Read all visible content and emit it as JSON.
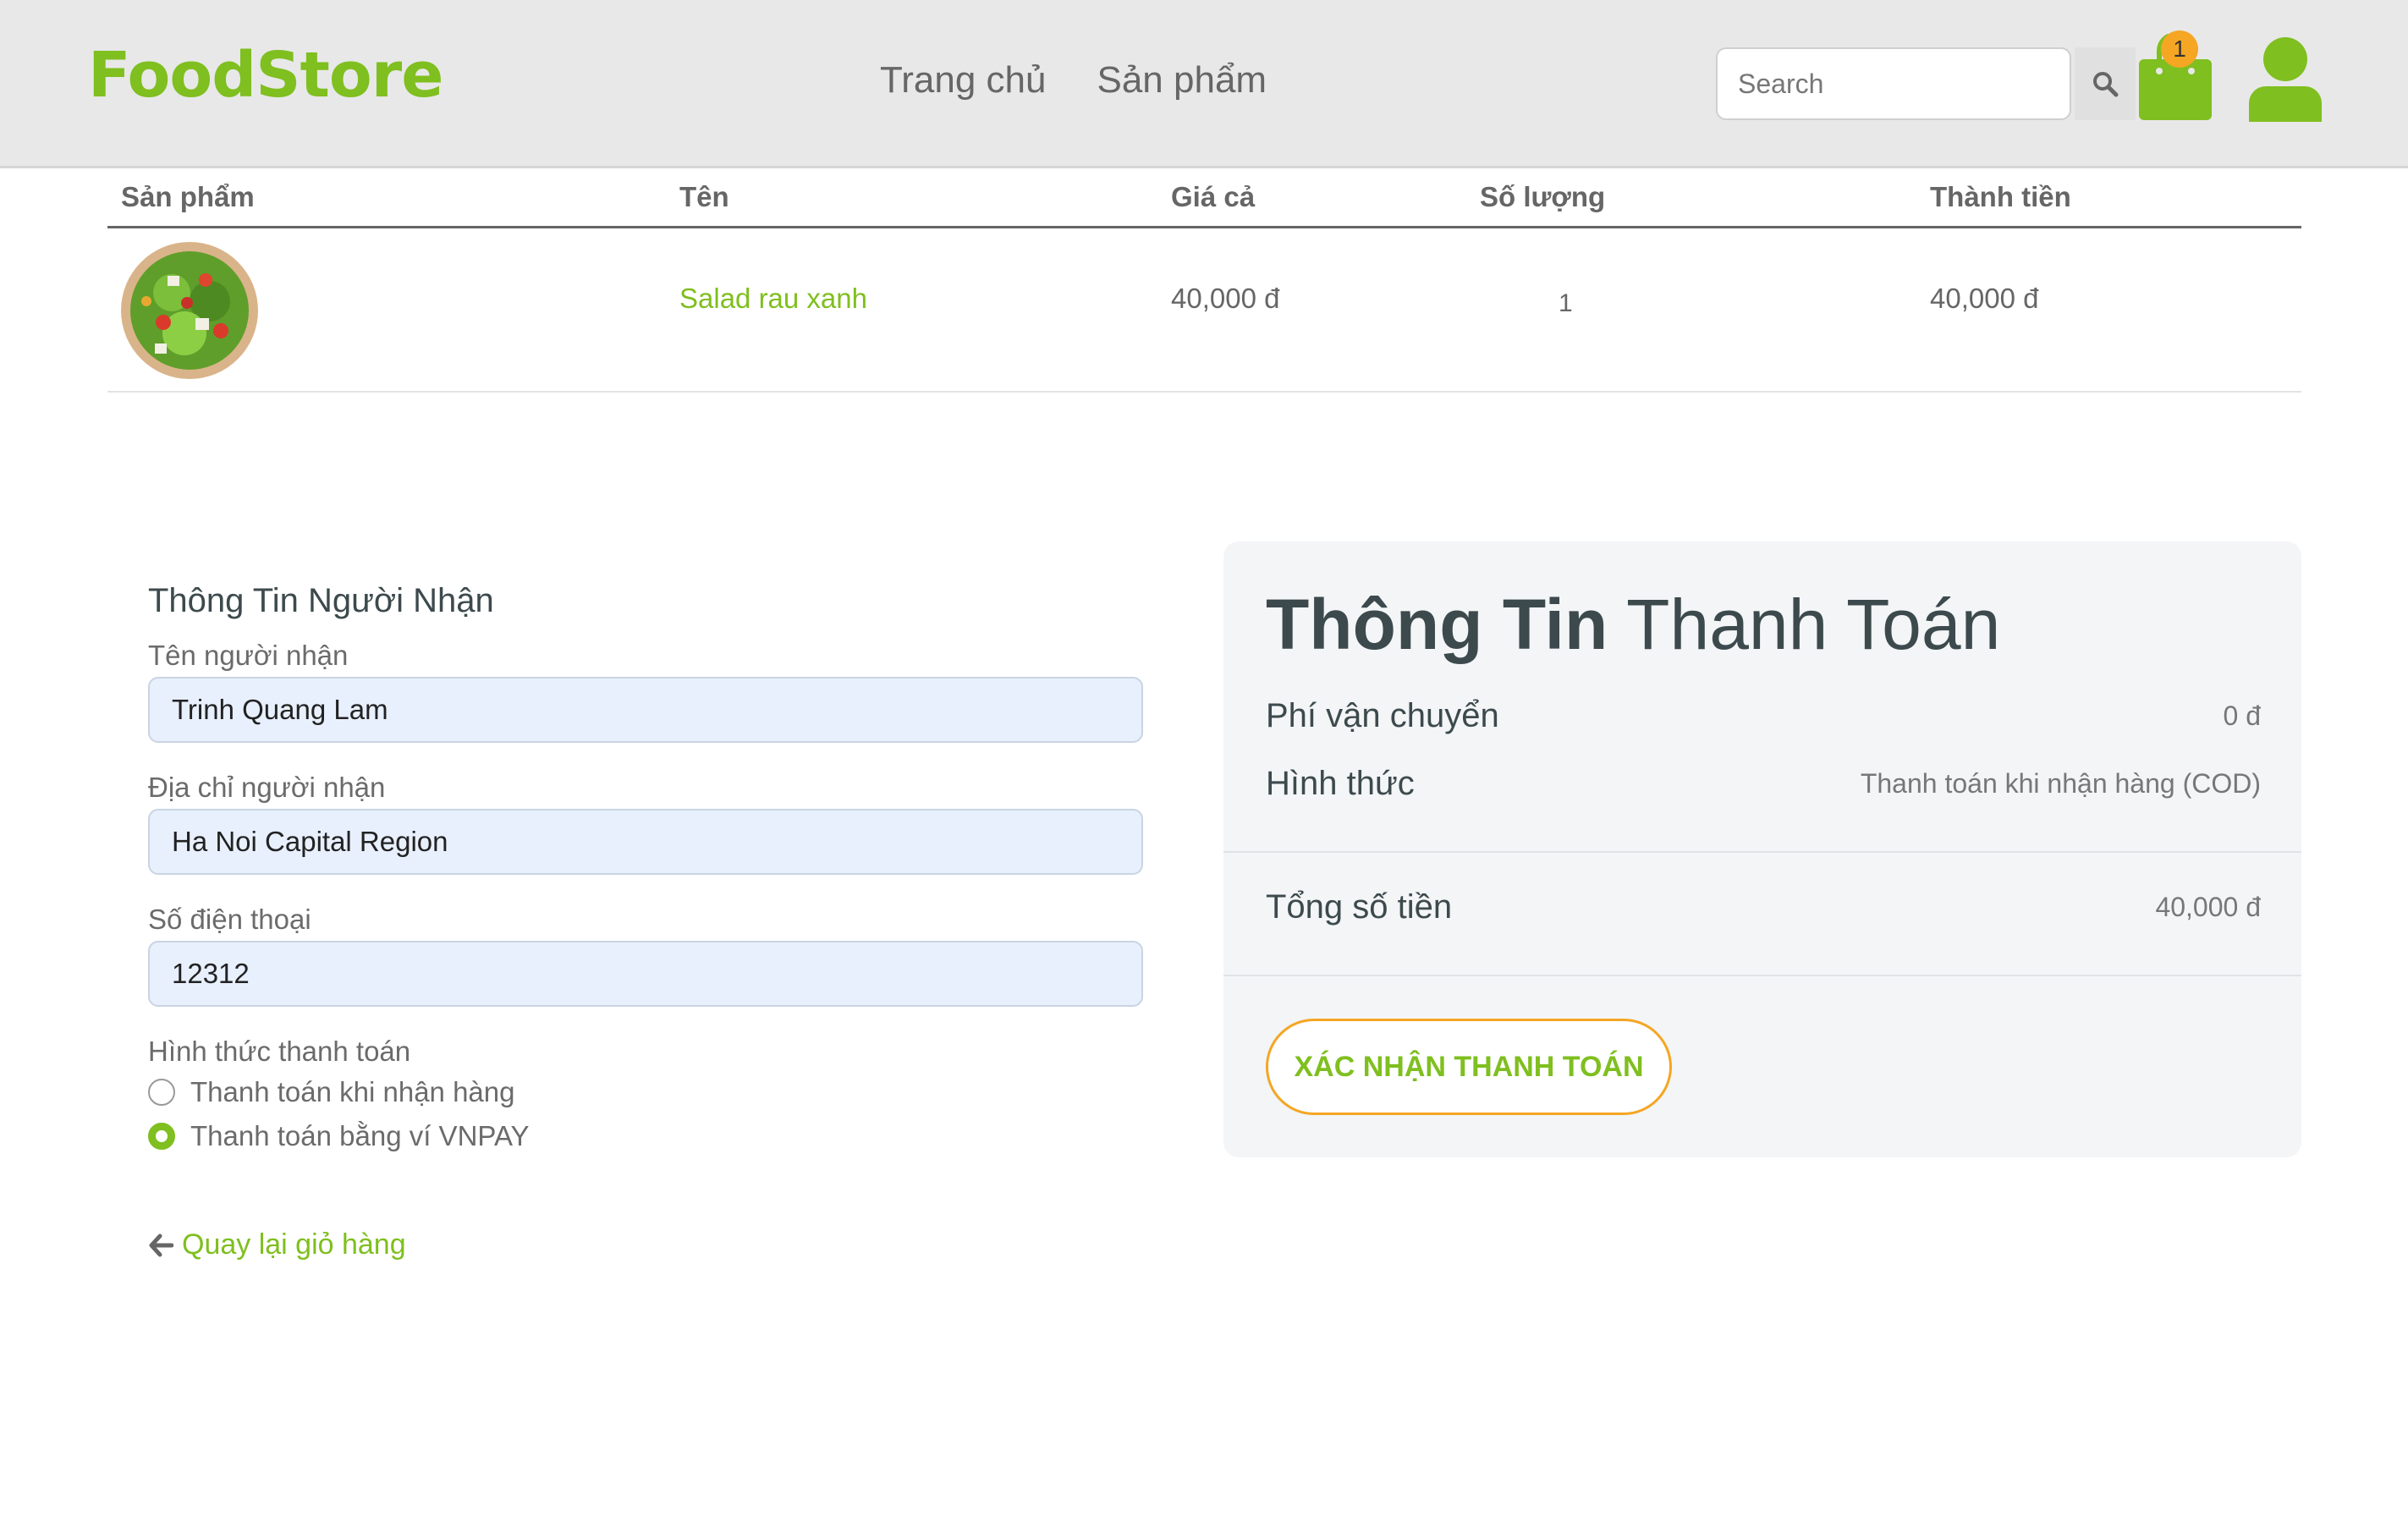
{
  "header": {
    "logo": "FoodStore",
    "nav": [
      "Trang chủ",
      "Sản phẩm"
    ],
    "search_placeholder": "Search",
    "cart_count": "1"
  },
  "table": {
    "headers": [
      "Sản phẩm",
      "Tên",
      "Giá cả",
      "Số lượng",
      "Thành tiền"
    ],
    "rows": [
      {
        "name": "Salad rau xanh",
        "price": "40,000 đ",
        "quantity": "1",
        "total": "40,000 đ"
      }
    ]
  },
  "form": {
    "title": "Thông Tin Người Nhận",
    "name_label": "Tên người nhận",
    "name_value": "Trinh Quang Lam",
    "address_label": "Địa chỉ người nhận",
    "address_value": "Ha Noi Capital Region",
    "phone_label": "Số điện thoại",
    "phone_value": "12312",
    "payment_label": "Hình thức thanh toán",
    "payment_options": [
      "Thanh toán khi nhận hàng",
      "Thanh toán bằng ví VNPAY"
    ],
    "payment_selected_index": 1,
    "back_link": "Quay lại giỏ hàng"
  },
  "payment": {
    "title_bold": "Thông Tin",
    "title_rest": " Thanh Toán",
    "shipping_label": "Phí vận chuyển",
    "shipping_value": "0 đ",
    "method_label": "Hình thức",
    "method_value": "Thanh toán khi nhận hàng (COD)",
    "total_label": "Tổng số tiền",
    "total_value": "40,000 đ",
    "confirm_button": "XÁC NHẬN THANH TOÁN"
  },
  "colors": {
    "brand_green": "#7fbf1f",
    "accent_orange": "#f5a623",
    "header_bg": "#e8e8e8",
    "panel_bg": "#f3f5f7"
  },
  "icons": [
    "search-icon",
    "shopping-bag-icon",
    "user-icon",
    "arrow-left-icon"
  ]
}
